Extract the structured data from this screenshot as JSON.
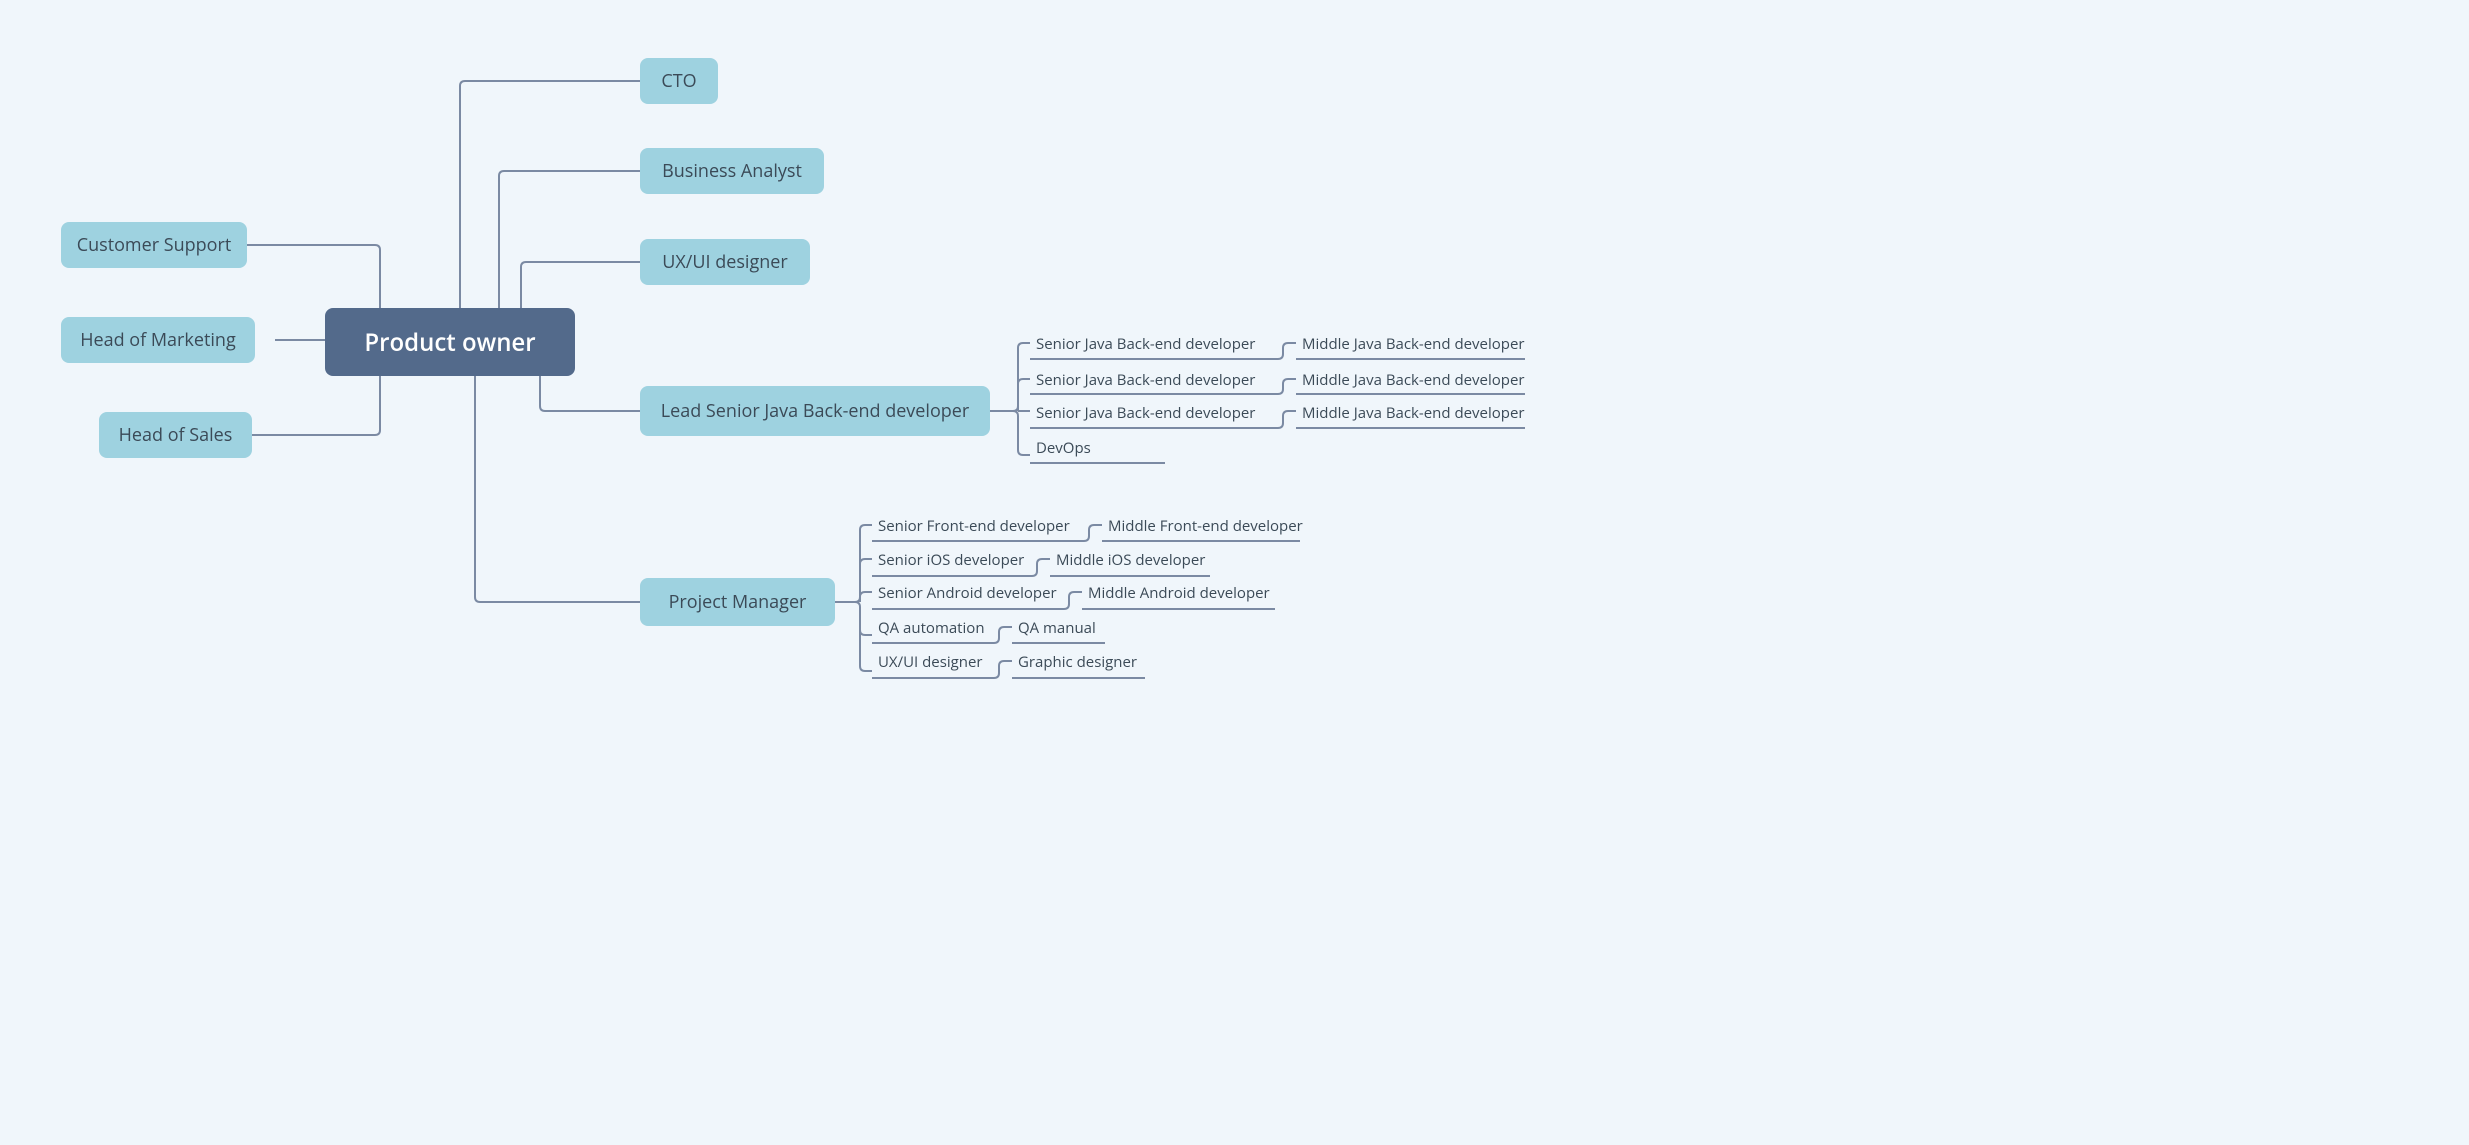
{
  "colors": {
    "root": "#536a8b",
    "pill": "#9ed2e0",
    "leaf_text": "#3b4a57",
    "stroke": "#7b8aa3",
    "bg": "#f0f6fb"
  },
  "root": {
    "label": "Product owner"
  },
  "left": [
    {
      "id": "customer-support",
      "label": "Customer Support"
    },
    {
      "id": "head-marketing",
      "label": "Head of Marketing"
    },
    {
      "id": "head-sales",
      "label": "Head of Sales"
    }
  ],
  "right": [
    {
      "id": "cto",
      "label": "CTO"
    },
    {
      "id": "business-analyst",
      "label": "Business Analyst"
    },
    {
      "id": "ux-ui-designer",
      "label": "UX/UI designer"
    },
    {
      "id": "lead-java",
      "label": "Lead Senior Java Back-end developer"
    },
    {
      "id": "project-manager",
      "label": "Project Manager"
    }
  ],
  "lead_java_children": {
    "rows": [
      {
        "a": "Senior  Java Back-end developer",
        "b": "Middle  Java Back-end developer"
      },
      {
        "a": "Senior  Java Back-end developer",
        "b": "Middle  Java Back-end developer"
      },
      {
        "a": "Senior  Java Back-end developer",
        "b": "Middle  Java Back-end developer"
      },
      {
        "a": "DevOps",
        "b": ""
      }
    ]
  },
  "pm_children": {
    "rows": [
      {
        "a": "Senior Front-end developer",
        "b": "Middle Front-end developer"
      },
      {
        "a": "Senior iOS developer",
        "b": "Middle iOS developer"
      },
      {
        "a": "Senior Android developer",
        "b": "Middle Android developer"
      },
      {
        "a": "QA automation",
        "b": "QA manual"
      },
      {
        "a": "UX/UI designer",
        "b": "Graphic designer"
      }
    ]
  }
}
